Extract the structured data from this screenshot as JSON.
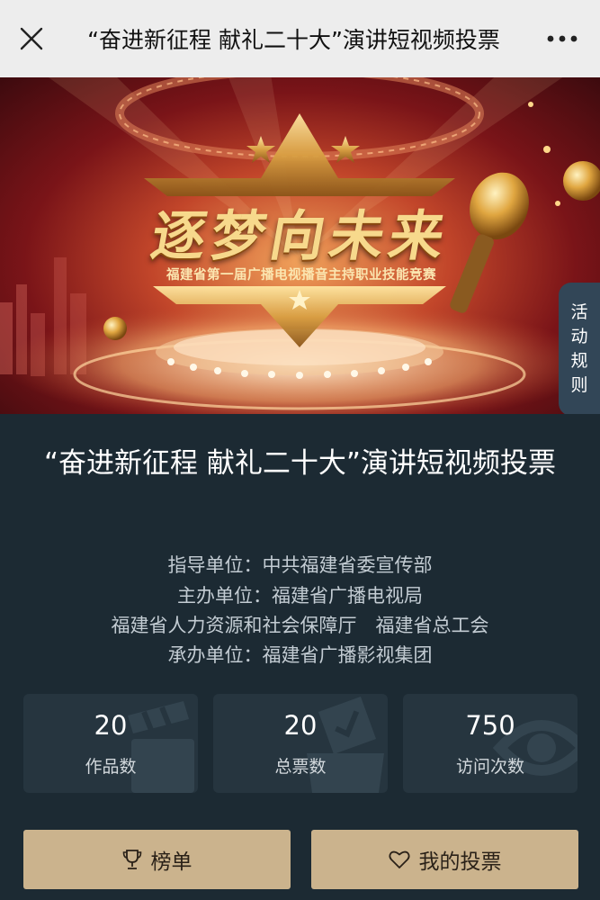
{
  "nav": {
    "title": "“奋进新征程 献礼二十大”演讲短视频投票"
  },
  "hero": {
    "title": "逐梦向未来",
    "subtitle": "福建省第一届广播电视播音主持职业技能竞赛",
    "rules_tab": "活动规则"
  },
  "event": {
    "title": "“奋进新征程 献礼二十大”演讲短视频投票",
    "organizers": [
      "指导单位：中共福建省委宣传部",
      "主办单位：福建省广播电视局",
      "福建省人力资源和社会保障厅　福建省总工会",
      "承办单位：福建省广播影视集团"
    ]
  },
  "stats": [
    {
      "value": "20",
      "label": "作品数",
      "icon": "clapperboard-icon"
    },
    {
      "value": "20",
      "label": "总票数",
      "icon": "ballot-icon"
    },
    {
      "value": "750",
      "label": "访问次数",
      "icon": "eye-icon"
    }
  ],
  "buttons": {
    "ranking": {
      "label": "榜单",
      "icon": "trophy-icon"
    },
    "my_votes": {
      "label": "我的投票",
      "icon": "heart-icon"
    }
  },
  "colors": {
    "nav_bg": "#ededed",
    "page_bg": "#1c2a33",
    "card_bg": "#26353f",
    "button_bg": "#cbb38d",
    "rules_tab_bg": "#324657"
  }
}
